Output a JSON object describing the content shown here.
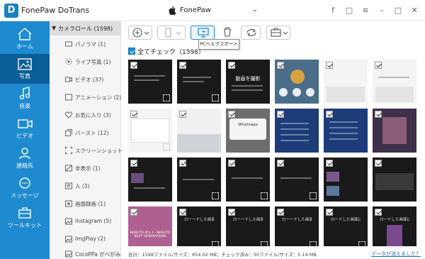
{
  "app": {
    "logo_text": "D",
    "title": "FonePaw DoTrans"
  },
  "device": {
    "name": "FonePaw"
  },
  "nav": [
    {
      "label": "ホーム",
      "icon": "home-icon"
    },
    {
      "label": "写真",
      "icon": "photo-icon",
      "active": true
    },
    {
      "label": "音楽",
      "icon": "music-icon"
    },
    {
      "label": "ビデオ",
      "icon": "video-icon"
    },
    {
      "label": "連絡先",
      "icon": "contacts-icon"
    },
    {
      "label": "メッセージ",
      "icon": "message-icon"
    },
    {
      "label": "ツールキット",
      "icon": "toolbox-icon"
    }
  ],
  "albums": {
    "header": "カメラロール (1598)",
    "items": [
      {
        "label": "パノラマ (1)",
        "icon": "panorama-icon"
      },
      {
        "label": "ライブ写真 (1)",
        "icon": "live-photo-icon"
      },
      {
        "label": "ビデオ (37)",
        "icon": "video-icon"
      },
      {
        "label": "アニメーション (2)",
        "icon": "animation-icon"
      },
      {
        "label": "お気に入り (3)",
        "icon": "heart-icon"
      },
      {
        "label": "バースト (12)",
        "icon": "burst-icon"
      },
      {
        "label": "スクリーンショット (1490)",
        "icon": "screenshot-icon"
      },
      {
        "label": "非表示 (1)",
        "icon": "hidden-icon"
      },
      {
        "label": "人 (3)",
        "icon": "people-icon"
      },
      {
        "label": "画面録画 (1)",
        "icon": "screen-recording-icon"
      },
      {
        "label": "Instagram (5)",
        "icon": "folder-icon"
      },
      {
        "label": "ImgPlay (2)",
        "icon": "folder-icon"
      },
      {
        "label": "CocoPPa がべがみ (2)",
        "icon": "folder-icon"
      }
    ]
  },
  "toolbar": {
    "tooltip": "PCへエクスポート",
    "buttons": [
      "add-icon",
      "device-export-icon",
      "pc-export-icon",
      "delete-icon",
      "refresh-icon",
      "toolbox-icon"
    ]
  },
  "select_all": {
    "label": "全てチェック（1598）"
  },
  "thumb_texts": {
    "t3": "動画を撮影",
    "t10": "Whatsapp",
    "t17": "ローードした画面はありません",
    "t18": "ローードした画面はありません",
    "t25": "ローードした画面はありません",
    "t26": "ロードした画面はありません",
    "t27": "ロードした画面はありません",
    "t29": "BORUTO-ボルト- NARUTO NEXT GENERATIONS"
  },
  "status": {
    "text": "合計：1598ファイル/サイズ：854.02 MB；チェック済み：30ファイル/サイズ：5.14 MB",
    "link": "データが消えました？"
  }
}
